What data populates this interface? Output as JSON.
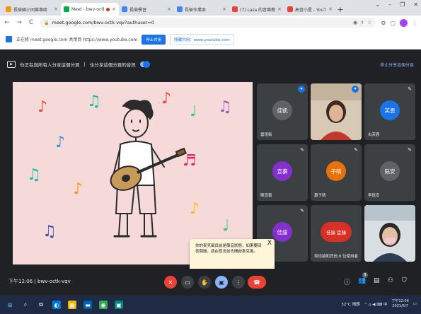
{
  "browser": {
    "tabs": [
      {
        "title": "長榮國小同樂專區",
        "favicon_color": "#f29900",
        "active": false
      },
      {
        "title": "Meet - bwv-octk",
        "favicon_color": "#00ac47",
        "active": true,
        "recording": true
      },
      {
        "title": "長榮學習",
        "favicon_color": "#4285f4",
        "active": false
      },
      {
        "title": "長榮作業區",
        "favicon_color": "#4285f4",
        "active": false
      },
      {
        "title": "(7) Lasa 的音樂教室",
        "favicon_color": "#ea4335",
        "active": false
      },
      {
        "title": "高音小星 - YouT",
        "favicon_color": "#ea4335",
        "active": false
      }
    ],
    "new_tab": "+",
    "close_glyph": "×",
    "window_controls": [
      "⌄",
      "–",
      "❐",
      "✕"
    ],
    "url": "meet.google.com/bwv-octk-vqv?authuser=0",
    "url_icons": [
      "◉",
      "⇪",
      "☆"
    ],
    "toolbar_icons": [
      "⚙",
      "▢"
    ]
  },
  "share_banner": {
    "message": "正在將 meet.google.com 共用到 https://www.youtube.com",
    "stop_button": "停止共用",
    "hide_button": "隱藏共用：www.youtube.com"
  },
  "meet_bar": {
    "presenting_text": "你正在與所有人分享這個分頁",
    "audio_text": "也分享這個分頁的音訊",
    "stop_presenting": "停止分享這個分頁"
  },
  "stage": {
    "background": "#f6dada",
    "note_colors": [
      "#e74c3c",
      "#1abc9c",
      "#3498db",
      "#9b59b6",
      "#f39c12",
      "#2ecc71",
      "#e91e63",
      "#f1c40f"
    ]
  },
  "participants": [
    {
      "name": "雲雨衛",
      "avatar_text": "佳凱",
      "avatar_color": "#5f6368",
      "mute": false,
      "speaking": true,
      "video": false
    },
    {
      "name": "",
      "avatar_text": "",
      "avatar_color": "",
      "mute": false,
      "speaking": true,
      "video": true,
      "highlighted": true
    },
    {
      "name": "古芙恩",
      "avatar_text": "芙恩",
      "avatar_color": "#1a73e8",
      "mute": true,
      "speaking": false,
      "video": false
    },
    {
      "name": "陳宣蓁",
      "avatar_text": "宣蓁",
      "avatar_color": "#8430ce",
      "mute": true,
      "speaking": false,
      "video": false
    },
    {
      "name": "蕭子晴",
      "avatar_text": "子晴",
      "avatar_color": "#e8710a",
      "mute": true,
      "speaking": false,
      "video": false
    },
    {
      "name": "李鈺安",
      "avatar_text": "鈺安",
      "avatar_color": "#5f6368",
      "mute": true,
      "speaking": false,
      "video": false
    },
    {
      "name": "",
      "avatar_text": "佳諭",
      "avatar_color": "#8430ce",
      "mute": true,
      "speaking": false,
      "video": false
    },
    {
      "name": "吳佳諭和其他 8 位使用者",
      "avatar_text": "佳諭 宜臻",
      "avatar_color": "#d93025",
      "mute": false,
      "speaking": false,
      "video": false
    },
    {
      "name": "",
      "avatar_text": "",
      "avatar_color": "",
      "mute": false,
      "speaking": false,
      "video": true
    }
  ],
  "popup": {
    "message": "你的麥克風目前是靜音狀態，如果要回答問題，請在發言前先開啟麥克風。",
    "close": "X"
  },
  "bottom": {
    "time": "下午12:06",
    "separator": "|",
    "meeting_code": "bwv-octk-vqv",
    "controls": [
      {
        "name": "mic-off-button",
        "glyph": "✕"
      },
      {
        "name": "camera-off-button",
        "glyph": "▭"
      },
      {
        "name": "raise-hand-button",
        "glyph": "✋"
      },
      {
        "name": "present-button",
        "glyph": "▣"
      },
      {
        "name": "more-options-button",
        "glyph": "⋮"
      },
      {
        "name": "leave-call-button",
        "glyph": "☎"
      }
    ],
    "right_icons": [
      {
        "name": "info-icon",
        "glyph": "ⓘ"
      },
      {
        "name": "people-icon",
        "glyph": "👥",
        "badge": "9"
      },
      {
        "name": "chat-icon",
        "glyph": "▤"
      },
      {
        "name": "activities-icon",
        "glyph": "⚇"
      },
      {
        "name": "host-controls-icon",
        "glyph": "⛉"
      }
    ]
  },
  "taskbar": {
    "apps": [
      "⊞",
      "⌕",
      "⧉",
      "◐",
      "▦",
      "▬",
      "◉",
      "▣"
    ],
    "weather": "32°C 晴朗",
    "tray_icons": "^ ⌂ ◀ ⌨ 中",
    "time": "下午12:06",
    "date": "2021/6/7"
  }
}
